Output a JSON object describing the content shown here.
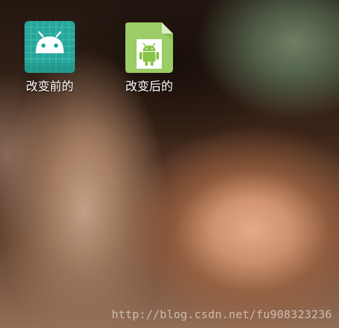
{
  "home_screen": {
    "apps": [
      {
        "label": "改变前的",
        "icon": "android-launcher-grid-icon",
        "color": "#26a69a"
      },
      {
        "label": "改变后的",
        "icon": "android-document-icon",
        "color": "#9ccc65"
      }
    ]
  },
  "watermark": {
    "text": "http://blog.csdn.net/fu908323236"
  }
}
